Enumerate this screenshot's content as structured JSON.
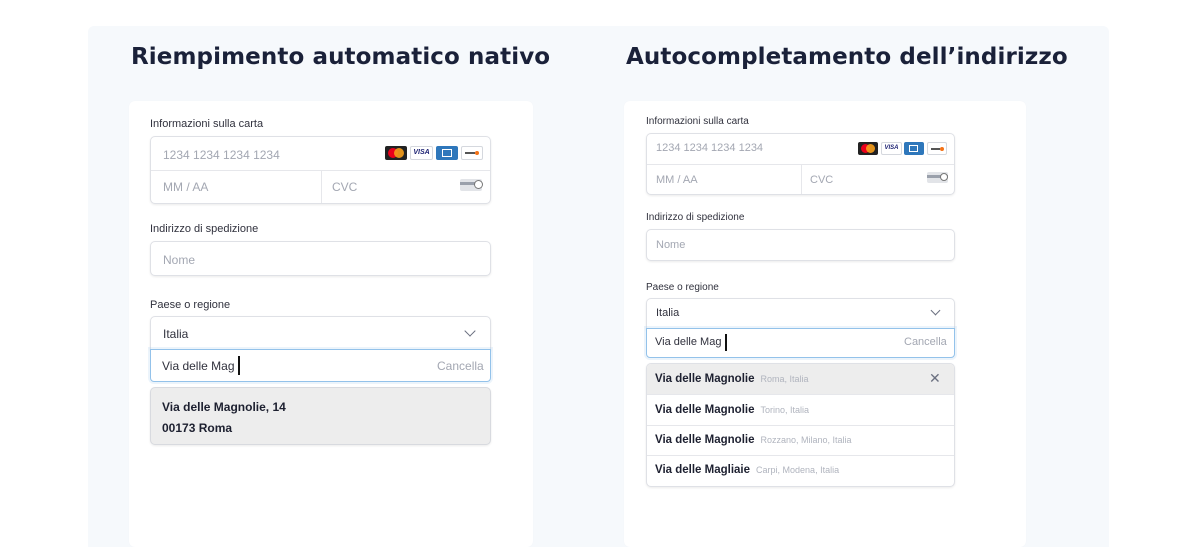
{
  "colors": {
    "canvas": "#f6f9fc",
    "title": "#1a2139",
    "focus": "#93c2ea",
    "mastercard_red": "#eb001b",
    "mastercard_orange": "#f79e1b",
    "visa": "#1a1f71",
    "amex": "#2e77bb",
    "discover": "#f47216"
  },
  "left": {
    "title": "Riempimento automatico nativo",
    "card_label": "Informazioni sulla carta",
    "card_number_placeholder": "1234 1234 1234 1234",
    "expiry_placeholder": "MM / AA",
    "cvc_placeholder": "CVC",
    "shipping_label": "Indirizzo di spedizione",
    "name_placeholder": "Nome",
    "country_label": "Paese o regione",
    "country_value": "Italia",
    "address_value": "Via delle Mag",
    "cancel_label": "Cancella",
    "autofill_line1": "Via delle Magnolie, 14",
    "autofill_line2": "00173 Roma"
  },
  "right": {
    "title": "Autocompletamento dell’indirizzo",
    "card_label": "Informazioni sulla carta",
    "card_number_placeholder": "1234 1234 1234 1234",
    "expiry_placeholder": "MM / AA",
    "cvc_placeholder": "CVC",
    "shipping_label": "Indirizzo di spedizione",
    "name_placeholder": "Nome",
    "country_label": "Paese o regione",
    "country_value": "Italia",
    "address_value": "Via delle Mag",
    "cancel_label": "Cancella",
    "suggestions": [
      {
        "main": "Via delle Magnolie",
        "secondary": "Roma, Italia"
      },
      {
        "main": "Via delle Magnolie",
        "secondary": "Torino, Italia"
      },
      {
        "main": "Via delle Magnolie",
        "secondary": "Rozzano, Milano, Italia"
      },
      {
        "main": "Via delle Magliaie",
        "secondary": "Carpi, Modena, Italia"
      }
    ]
  },
  "icons": {
    "mastercard": "mastercard-icon",
    "visa": "visa-icon",
    "amex": "amex-icon",
    "discover": "discover-icon",
    "cvc": "cvc-card-icon",
    "dropdown": "chevron-down-icon",
    "close": "close-icon"
  },
  "brand_text": {
    "visa": "VISA"
  }
}
